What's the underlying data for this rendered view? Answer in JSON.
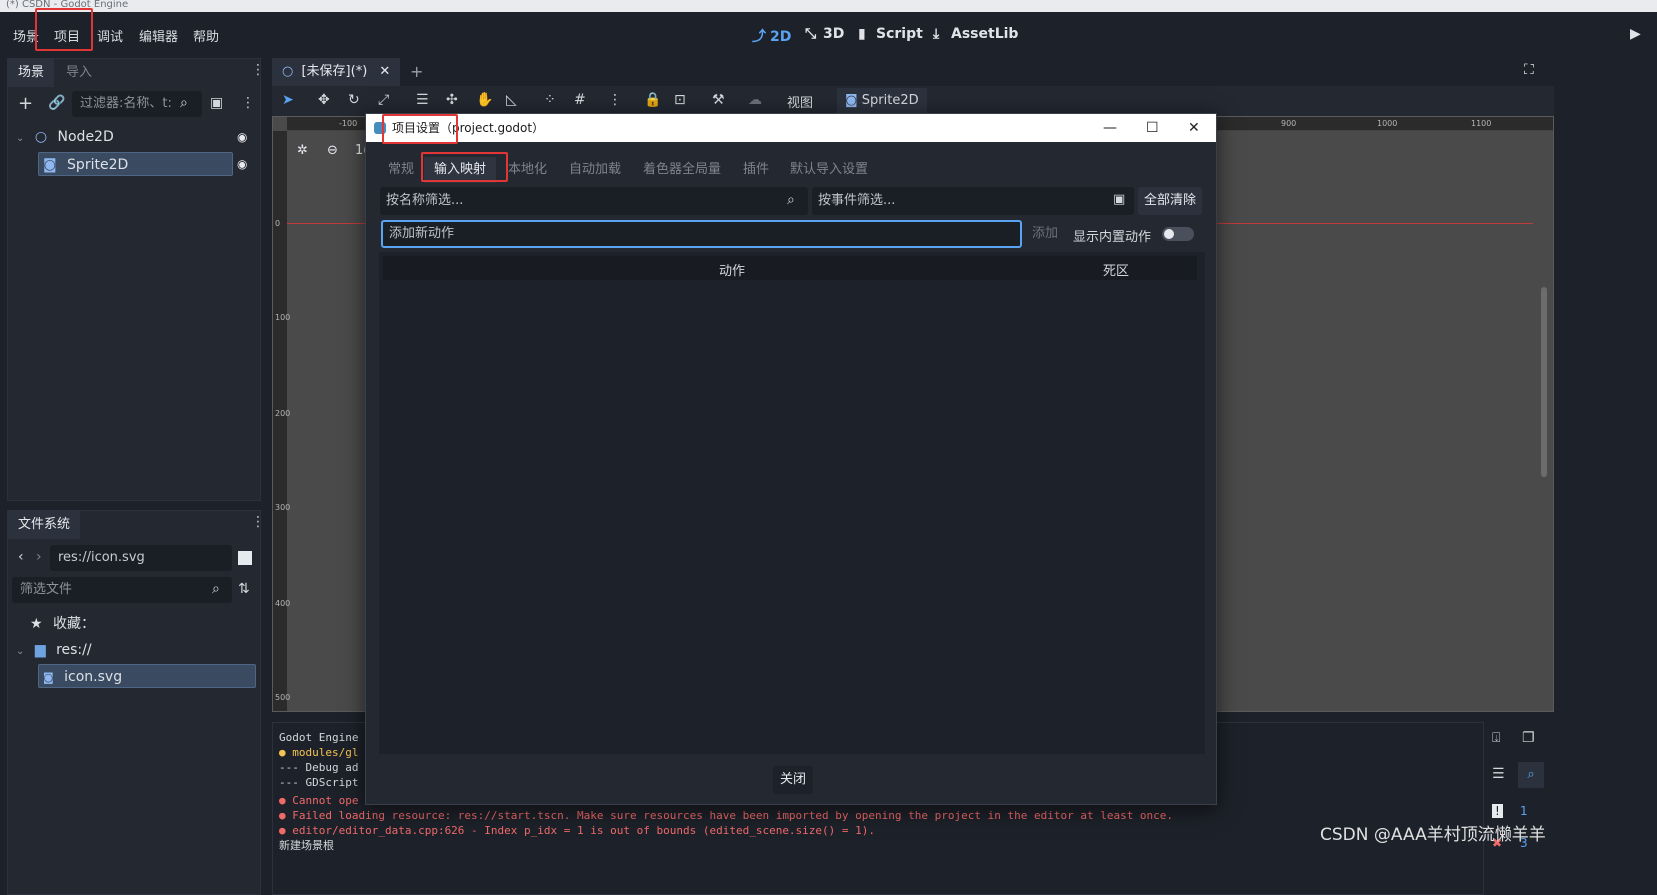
{
  "os_title": "(*) CSDN - Godot Engine",
  "menu": [
    "场景",
    "项目",
    "调试",
    "编辑器",
    "帮助"
  ],
  "workspaces": [
    {
      "label": "2D",
      "icon": "2d-icon"
    },
    {
      "label": "3D",
      "icon": "3d-icon"
    },
    {
      "label": "Script",
      "icon": "script-icon"
    },
    {
      "label": "AssetLib",
      "icon": "assetlib-icon"
    }
  ],
  "scene_dock": {
    "tabs": [
      "场景",
      "导入"
    ],
    "filter_placeholder": "过滤器:名称、t:",
    "nodes": [
      "Node2D",
      "Sprite2D"
    ]
  },
  "fs_dock": {
    "tab": "文件系统",
    "path": "res://icon.svg",
    "filter_placeholder": "筛选文件",
    "favorites": "收藏：",
    "root": "res://",
    "file": "icon.svg"
  },
  "editor": {
    "scene_tab": "[未保存](*)",
    "toolbar_view": "视图",
    "toolbar_node": "Sprite2D",
    "zoom_partial": "1(",
    "ruler_h": [
      "-100",
      "900",
      "1000",
      "1100"
    ],
    "ruler_v": [
      "0",
      "100",
      "200",
      "300",
      "400",
      "500"
    ]
  },
  "dialog": {
    "title": "项目设置（project.godot）",
    "tabs": [
      "常规",
      "输入映射",
      "本地化",
      "自动加载",
      "着色器全局量",
      "插件",
      "默认导入设置"
    ],
    "filter_name_placeholder": "按名称筛选...",
    "filter_event_placeholder": "按事件筛选...",
    "clear_all": "全部清除",
    "add_action_placeholder": "添加新动作",
    "add_button": "添加",
    "show_builtin": "显示内置动作",
    "col_action": "动作",
    "col_deadzone": "死区",
    "close": "关闭"
  },
  "output": [
    {
      "type": "plain",
      "text": "Godot Engine"
    },
    {
      "type": "warn",
      "text": "● modules/gl"
    },
    {
      "type": "plain",
      "text": "--- Debug ad"
    },
    {
      "type": "plain",
      "text": "--- GDScript"
    },
    {
      "type": "err",
      "text": "● Cannot ope"
    },
    {
      "type": "err",
      "text": "● Failed loading resource: res://start.tscn. Make sure resources have been imported by opening the project in the editor at least once."
    },
    {
      "type": "err",
      "text": "● editor/editor_data.cpp:626 - Index p_idx = 1 is out of bounds (edited_scene.size() = 1)."
    },
    {
      "type": "plain",
      "text": "新建场景根"
    }
  ],
  "output_side": {
    "warn_count": "1",
    "err_count": "3"
  },
  "watermark": "CSDN @AAA羊村顶流懒羊羊",
  "colors": {
    "accent": "#5aa3f2",
    "highlight_box": "#e23636",
    "error": "#f06a6a",
    "warning": "#f5c451"
  }
}
